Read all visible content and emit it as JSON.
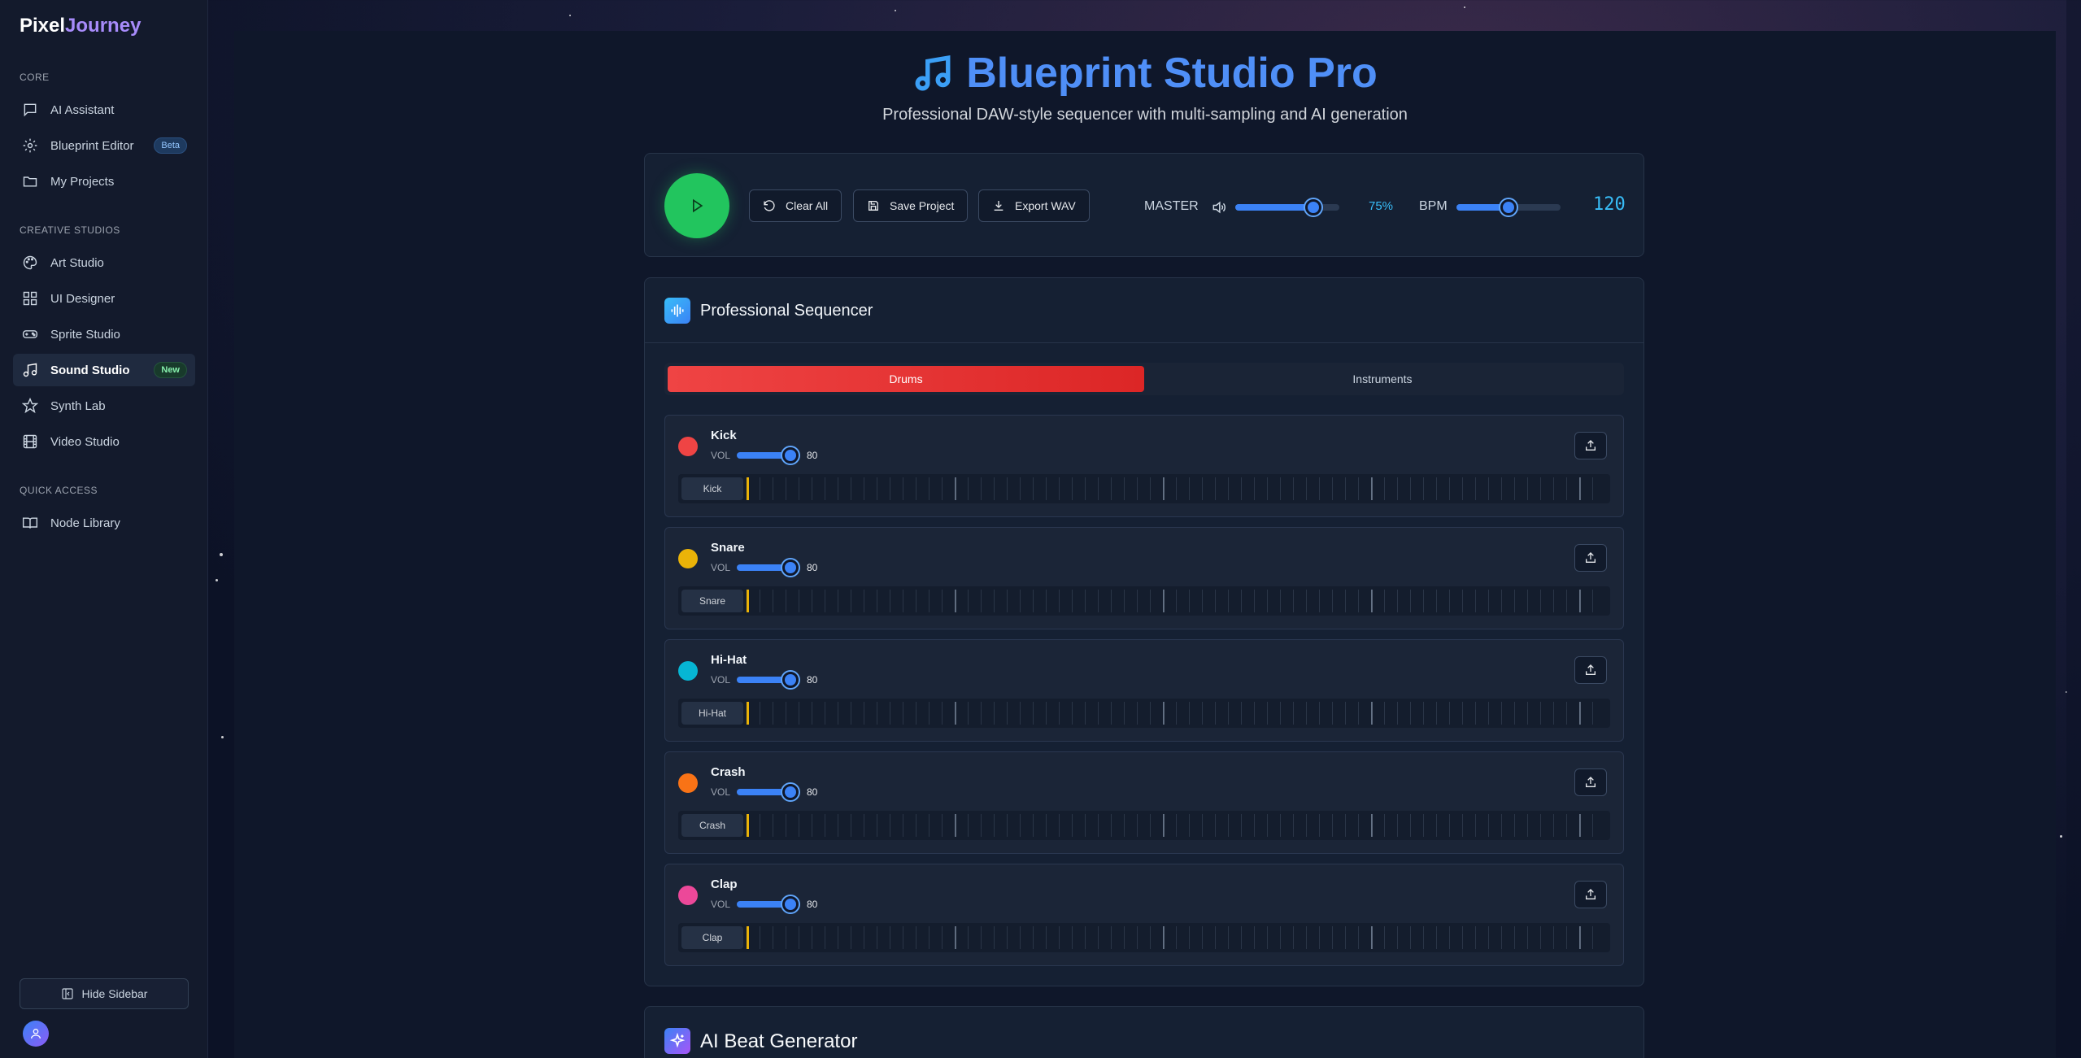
{
  "app": {
    "logo_part1": "Pixel",
    "logo_part2": "Journey"
  },
  "sidebar": {
    "sections": [
      {
        "title": "CORE"
      },
      {
        "title": "CREATIVE STUDIOS"
      },
      {
        "title": "QUICK ACCESS"
      }
    ],
    "items": [
      {
        "label": "AI Assistant",
        "icon": "message-icon"
      },
      {
        "label": "Blueprint Editor",
        "icon": "gear-icon",
        "badge": "Beta"
      },
      {
        "label": "My Projects",
        "icon": "folder-icon"
      },
      {
        "label": "Art Studio",
        "icon": "palette-icon"
      },
      {
        "label": "UI Designer",
        "icon": "grid-icon"
      },
      {
        "label": "Sprite Studio",
        "icon": "gamepad-icon"
      },
      {
        "label": "Sound Studio",
        "icon": "music-icon",
        "badge": "New",
        "active": true
      },
      {
        "label": "Synth Lab",
        "icon": "star-icon"
      },
      {
        "label": "Video Studio",
        "icon": "film-icon"
      },
      {
        "label": "Node Library",
        "icon": "book-icon"
      }
    ],
    "hide_label": "Hide Sidebar"
  },
  "header": {
    "title": "Blueprint Studio Pro",
    "subtitle": "Professional DAW-style sequencer with multi-sampling and AI generation"
  },
  "transport": {
    "clear_label": "Clear All",
    "save_label": "Save Project",
    "export_label": "Export WAV",
    "master_label": "MASTER",
    "master_pct_text": "75%",
    "master_value": 0.75,
    "bpm_label": "BPM",
    "bpm_value": "120",
    "bpm_fraction": 0.5
  },
  "sequencer": {
    "title": "Professional Sequencer",
    "tabs": [
      {
        "label": "Drums",
        "active": true
      },
      {
        "label": "Instruments",
        "active": false
      }
    ],
    "vol_label": "VOL",
    "tracks": [
      {
        "name": "Kick",
        "volume": "80",
        "color": "#ef4444"
      },
      {
        "name": "Snare",
        "volume": "80",
        "color": "#eab308"
      },
      {
        "name": "Hi-Hat",
        "volume": "80",
        "color": "#06b6d4"
      },
      {
        "name": "Crash",
        "volume": "80",
        "color": "#f97316"
      },
      {
        "name": "Clap",
        "volume": "80",
        "color": "#ec4899"
      }
    ]
  },
  "ai_generator": {
    "title": "AI Beat Generator"
  },
  "colors": {
    "accent": "#3b82f6",
    "play": "#22c55e",
    "drums_tab": "#ef4444"
  }
}
